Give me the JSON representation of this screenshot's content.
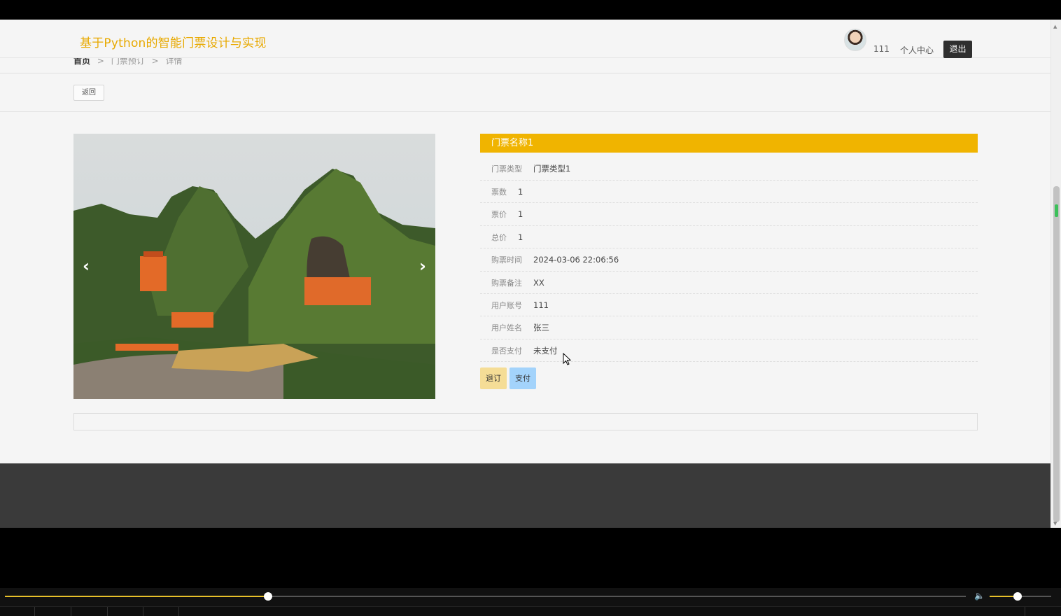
{
  "header": {
    "site_title": "基于Python的智能门票设计与实现",
    "user_name": "111",
    "personal_center": "个人中心",
    "logout": "退出"
  },
  "breadcrumb": [
    "首页",
    "门票预订",
    "详情"
  ],
  "back_label": "返回",
  "ticket": {
    "title": "门票名称1",
    "fields": [
      {
        "label": "门票类型",
        "value": "门票类型1"
      },
      {
        "label": "票数",
        "value": "1"
      },
      {
        "label": "票价",
        "value": "1"
      },
      {
        "label": "总价",
        "value": "1"
      },
      {
        "label": "购票时间",
        "value": "2024-03-06 22:06:56"
      },
      {
        "label": "购票备注",
        "value": "XX"
      },
      {
        "label": "用户账号",
        "value": "111"
      },
      {
        "label": "用户姓名",
        "value": "张三"
      },
      {
        "label": "是否支付",
        "value": "未支付"
      }
    ],
    "refund_label": "退订",
    "pay_label": "支付"
  },
  "carousel": {
    "prev_icon": "chevron-left-icon",
    "next_icon": "chevron-right-icon"
  },
  "player": {
    "progress_fraction": 0.274,
    "volume_fraction": 0.45
  },
  "colors": {
    "accent": "#f0b400",
    "title": "#e8a900",
    "refund": "#f5dd96",
    "pay": "#a3d3fb",
    "footer": "#3a3a3a"
  }
}
